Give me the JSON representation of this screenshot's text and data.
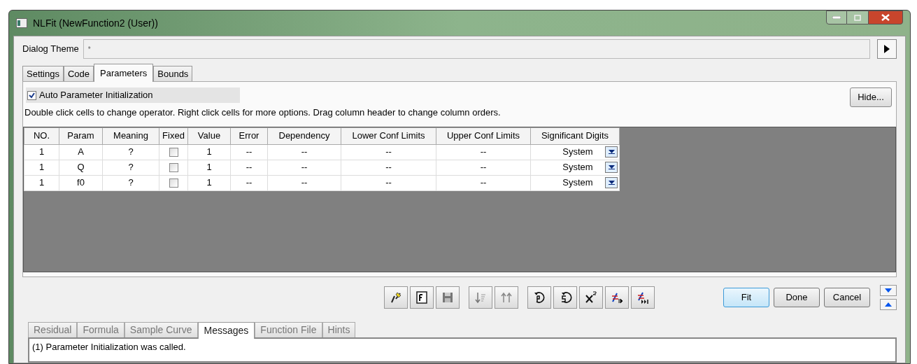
{
  "window": {
    "title": "NLFit (NewFunction2 (User))"
  },
  "dialog_theme": {
    "label": "Dialog Theme",
    "value": "*"
  },
  "tabs": [
    {
      "label": "Settings",
      "selected": false
    },
    {
      "label": "Code",
      "selected": false
    },
    {
      "label": "Parameters",
      "selected": true
    },
    {
      "label": "Bounds",
      "selected": false
    }
  ],
  "auto_init": {
    "label": "Auto Parameter Initialization",
    "checked": true
  },
  "hide_button": "Hide...",
  "hint": "Double click cells to change operator. Right click cells for more options. Drag column header to change column orders.",
  "table": {
    "columns": [
      "NO.",
      "Param",
      "Meaning",
      "Fixed",
      "Value",
      "Error",
      "Dependency",
      "Lower Conf Limits",
      "Upper Conf Limits",
      "Significant Digits"
    ],
    "rows": [
      {
        "no": "1",
        "param": "A",
        "meaning": "?",
        "fixed": false,
        "value": "1",
        "error": "--",
        "dependency": "--",
        "lower": "--",
        "upper": "--",
        "digits": "System"
      },
      {
        "no": "1",
        "param": "Q",
        "meaning": "?",
        "fixed": false,
        "value": "1",
        "error": "--",
        "dependency": "--",
        "lower": "--",
        "upper": "--",
        "digits": "System"
      },
      {
        "no": "1",
        "param": "f0",
        "meaning": "?",
        "fixed": false,
        "value": "1",
        "error": "--",
        "dependency": "--",
        "lower": "--",
        "upper": "--",
        "digits": "System"
      }
    ]
  },
  "buttons": [
    {
      "label": "Fit",
      "selected": true
    },
    {
      "label": "Done",
      "selected": false
    },
    {
      "label": "Cancel",
      "selected": false
    }
  ],
  "bottom_tabs": [
    {
      "label": "Residual",
      "selected": false
    },
    {
      "label": "Formula",
      "selected": false
    },
    {
      "label": "Sample Curve",
      "selected": false
    },
    {
      "label": "Messages",
      "selected": true
    },
    {
      "label": "Function File",
      "selected": false
    },
    {
      "label": "Hints",
      "selected": false
    }
  ],
  "messages": [
    "(1) Parameter Initialization was called."
  ]
}
